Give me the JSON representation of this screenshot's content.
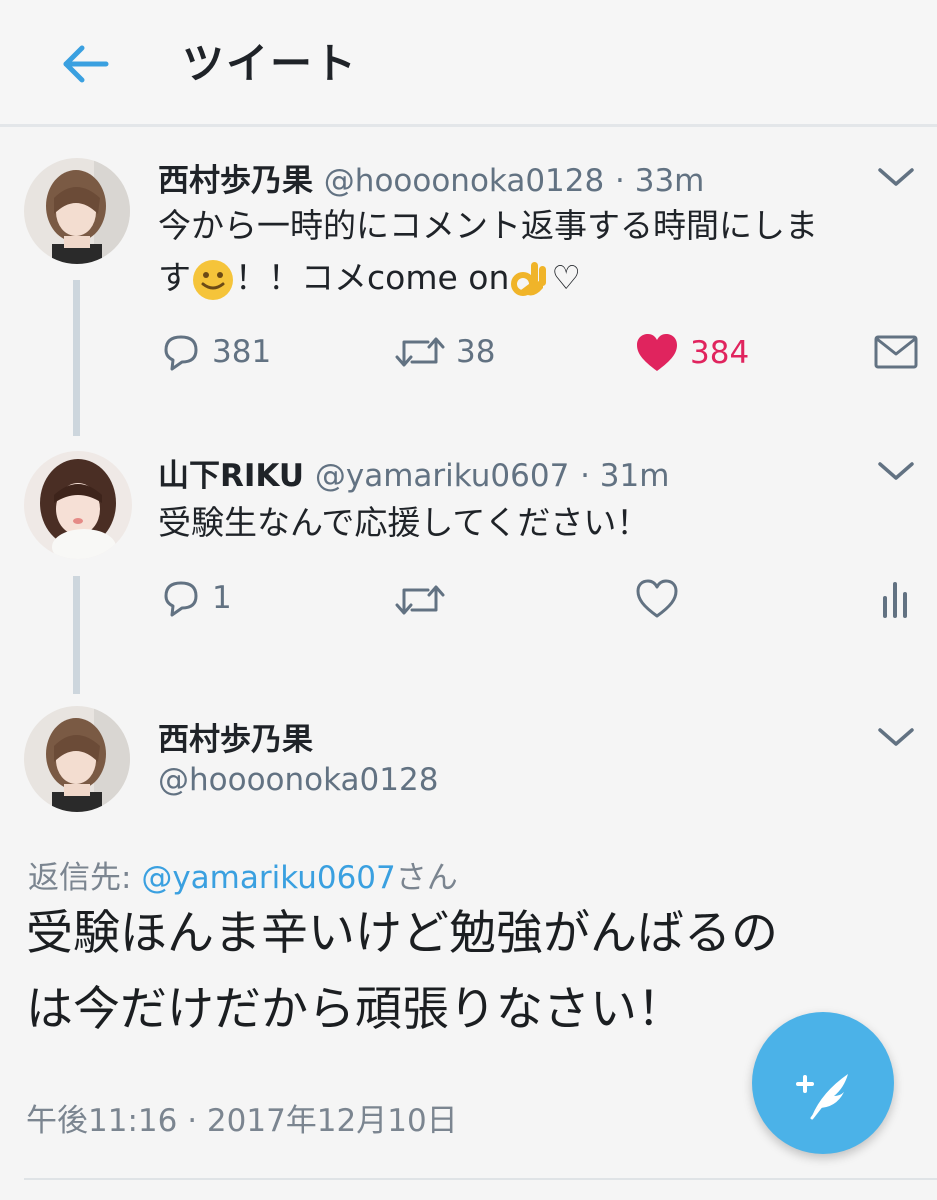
{
  "header": {
    "title": "ツイート",
    "back_icon": "arrow-left-icon",
    "accent": "#3aa0e0"
  },
  "tweets": [
    {
      "name": "西村歩乃果",
      "handle": "@hoooonoka0128",
      "time": "· 33m",
      "text_line1": "今から一時的にコメント返事する時間にしま",
      "text_line2_a": "す",
      "text_line2_b": "！！コメcome on",
      "text_line2_c": "♡",
      "reply_count": "381",
      "retweet_count": "38",
      "like_count": "384",
      "liked": true
    },
    {
      "name": "山下RIKU",
      "handle": "@yamariku0607",
      "time": "· 31m",
      "text": "受験生なんで応援してください！",
      "reply_count": "1"
    }
  ],
  "main_tweet": {
    "name": "西村歩乃果",
    "handle": "@hoooonoka0128",
    "reply_prefix": "返信先: ",
    "reply_to": "@yamariku0607",
    "reply_suffix": "さん",
    "text_line1": "受験ほんま辛いけど勉強がんばるの",
    "text_line2": "は今だけだから頑張りなさい！",
    "timestamp": "午後11:16 · 2017年12月10日"
  },
  "colors": {
    "like": "#e0245e",
    "icon_gray": "#627282",
    "fab": "#4bb2e8"
  }
}
